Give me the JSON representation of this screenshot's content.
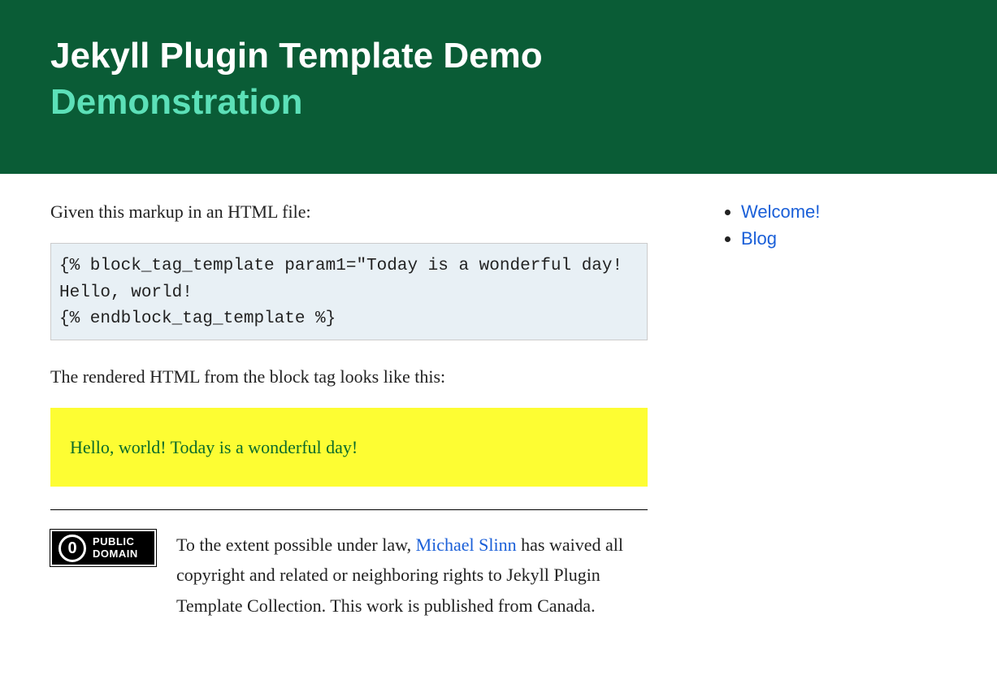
{
  "header": {
    "title": "Jekyll Plugin Template Demo",
    "subtitle": "Demonstration"
  },
  "sidebar": {
    "items": [
      {
        "label": "Welcome!"
      },
      {
        "label": "Blog"
      }
    ]
  },
  "main": {
    "intro": "Given this markup in an HTML file:",
    "codeSample": "{% block_tag_template param1=\"Today is a wonderful day!\nHello, world!\n{% endblock_tag_template %}",
    "renderedLead": "The rendered HTML from the block tag looks like this:",
    "renderedOutput": "Hello, world! Today is a wonderful day!"
  },
  "license": {
    "badgeTop": "PUBLIC",
    "badgeBottom": "DOMAIN",
    "textBefore": "To the extent possible under law, ",
    "authorName": "Michael Slinn",
    "textAfter": " has waived all copyright and related or neighboring rights to Jekyll Plugin Template Collection. This work is published from Canada."
  }
}
